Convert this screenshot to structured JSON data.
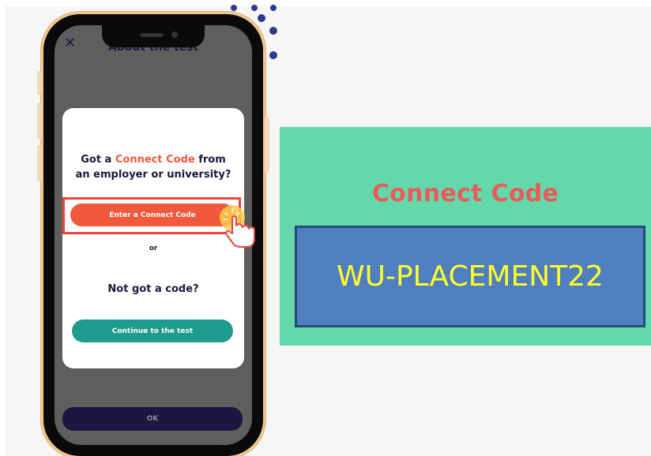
{
  "phone": {
    "close_glyph": "✕",
    "screen_title": "About the test",
    "modal": {
      "question_prefix": "Got a ",
      "question_highlight": "Connect Code",
      "question_suffix_line1": " from",
      "question_line2": "an employer or university?",
      "primary_button": "Enter a Connect Code",
      "separator": "or",
      "secondary_heading": "Not got a code?",
      "secondary_button": "Continue to the test"
    },
    "ok_button": "OK"
  },
  "code_panel": {
    "label": "Connect Code",
    "code": "WU-PLACEMENT22"
  },
  "colors": {
    "accent_orange": "#ef5a3c",
    "teal_button": "#1d9b8c",
    "panel_green": "#64d8ab",
    "code_box_blue": "#4f7fbf",
    "code_text_yellow": "#ffff2e",
    "label_red": "#e95b5b",
    "navy": "#1d1640"
  },
  "icons": [
    "close-icon",
    "pointer-hand-icon"
  ]
}
